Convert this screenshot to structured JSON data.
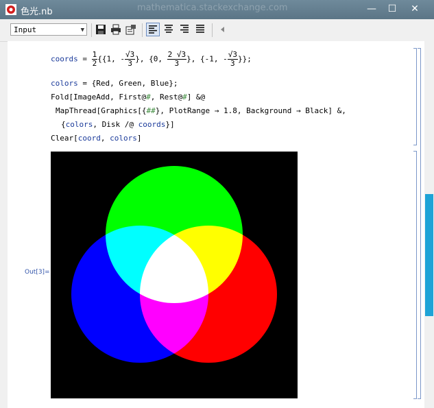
{
  "window": {
    "title": "色光.nb",
    "background_text": "mathematica.stackexchange.com",
    "minimize": "—",
    "maximize": "☐",
    "close": "✕"
  },
  "toolbar": {
    "style_value": "Input"
  },
  "cell": {
    "line1_var": "coords",
    "line1_eq": " = ",
    "half_num": "1",
    "half_den": "2",
    "open1": "{{1, -",
    "s3": "3",
    "den3": "3",
    "sep1": "}, {0, ",
    "two": "2",
    "sep2": "}, {-1, -",
    "close1": "}};",
    "line2_var": "colors",
    "line2_rest": " = {Red, Green, Blue};",
    "line3a": "Fold[ImageAdd, First@",
    "hash": "#",
    "line3b": ", Rest@",
    "line3c": "] &@",
    "line4a": "MapThread[Graphics[{",
    "hashhash": "##",
    "line4b": "}, PlotRange → 1.8, Background → Black] &,",
    "line5a": "{",
    "line5_colors": "colors",
    "line5b": ", Disk /@ ",
    "line5_coords": "coords",
    "line5c": "}]",
    "line6a": "Clear[",
    "line6_coord": "coord",
    "line6b": ", ",
    "line6_colors": "colors",
    "line6c": "]"
  },
  "output": {
    "label": "Out[3]="
  },
  "colors": {
    "red": "#ff0000",
    "green": "#00ff00",
    "blue": "#0000ff",
    "background": "#000000",
    "scroll_thumb": "#1ea3d6"
  }
}
